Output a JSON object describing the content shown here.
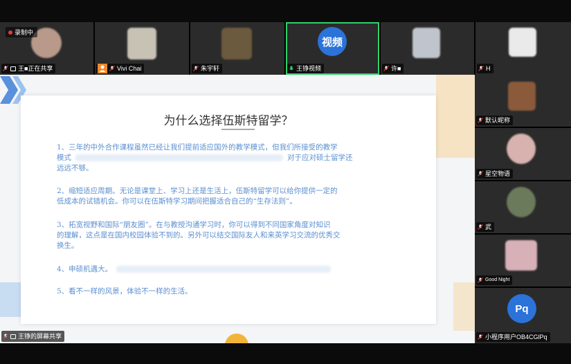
{
  "top_strip": [
    {
      "name": "王■正在共享",
      "recording_label": "录制中"
    },
    {
      "name": "Vivi Chai"
    },
    {
      "name": "朱宇轩"
    },
    {
      "name": "王铮视频",
      "avatar_text": "视频"
    },
    {
      "name": "许■"
    },
    {
      "name": "H"
    }
  ],
  "right_column": [
    {
      "name": "默认昵称"
    },
    {
      "name": "星空物语"
    },
    {
      "name": "武"
    },
    {
      "name": "Good Night"
    },
    {
      "name": "小程序用户OB4CGlPq",
      "avatar_text": "Pq"
    }
  ],
  "screen_share": {
    "sharer_label": "王铮的屏幕共享",
    "title": "为什么选择伍斯特留学？",
    "paragraphs": [
      {
        "lines": [
          "1、三年的中外合作课程虽然已经让我们提前适应国外的教学模式，但我们所接受的教学",
          "模式",
          "对于应对硕士留学还",
          "远远不够。"
        ]
      },
      {
        "lines": [
          "2、缩短适应周期。无论是课堂上、学习上还是生活上，伍斯特留学可以给你提供一定的",
          "低成本的试错机会。你可以在伍斯特学习期间把握适合自己的“生存法则”。"
        ]
      },
      {
        "lines": [
          "3、拓宽视野和国际“朋友圈”。在与教授沟通学习时，你可以得到不同国家角度对知识",
          "的理解，这点是在国内校园体验不到的。另外可以结交国际友人和来英学习交流的优秀交",
          "换生。"
        ]
      },
      {
        "lines": [
          "4、申硕机遇大。"
        ]
      },
      {
        "lines": [
          "5、看不一样的风景，体验不一样的生活。"
        ]
      }
    ]
  },
  "colors": {
    "active_border": "#2ed16b",
    "badge_blue": "#2b72d9",
    "slide_text": "#5b8fd0",
    "tile_bg": "#2b2b2b"
  }
}
